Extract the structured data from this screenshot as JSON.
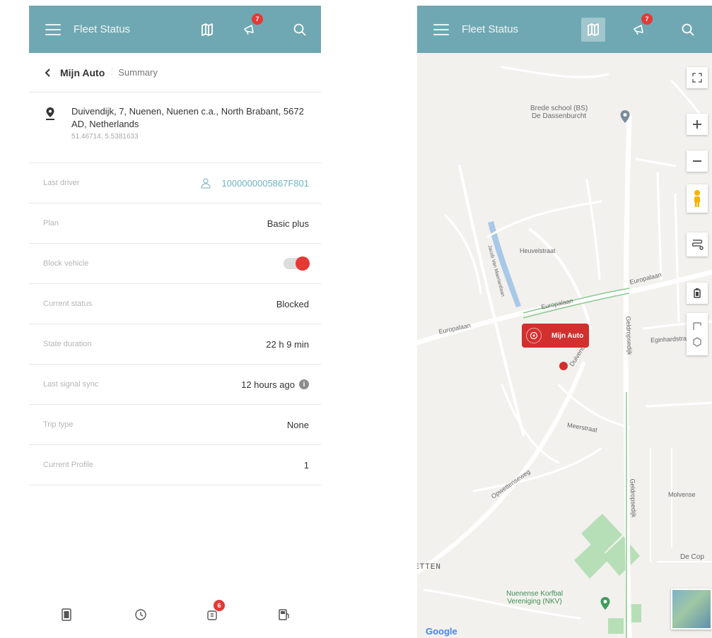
{
  "app": {
    "title": "Fleet Status",
    "notification_count": "7",
    "accent": "#6fa8b3",
    "alert": "#e53935"
  },
  "detail": {
    "car_name": "Mijn Auto",
    "tab": "Summary",
    "address": "Duivendijk, 7, Nuenen, Nuenen c.a., North Brabant, 5672 AD, Netherlands",
    "coordinates": "51.46714, 5.5381633",
    "rows": [
      {
        "label": "Last driver",
        "value": "1000000005867F801"
      },
      {
        "label": "Plan",
        "value": "Basic plus"
      },
      {
        "label": "Block vehicle",
        "value": ""
      },
      {
        "label": "Current status",
        "value": "Blocked"
      },
      {
        "label": "State duration",
        "value": "22 h 9 min"
      },
      {
        "label": "Last signal sync",
        "value": "12 hours ago"
      },
      {
        "label": "Trip type",
        "value": "None"
      },
      {
        "label": "Current Profile",
        "value": "1"
      }
    ],
    "block_vehicle_on": true
  },
  "bottom_nav": {
    "badge_count": "6",
    "items": [
      "summary-icon",
      "history-icon",
      "alerts-icon",
      "fuel-icon"
    ]
  },
  "map": {
    "marker_label": "Mijn Auto",
    "pois": [
      {
        "name": "Brede school (BS)\nDe Dassenburcht"
      },
      {
        "name": "Nuenense Korfbal\nVereniging (NKV)"
      }
    ],
    "streets": [
      "Europalaan",
      "Europalaan",
      "Europalaan",
      "Geldropsedijk",
      "Geldropsedijk",
      "Opwettenseweg",
      "Duivendijk",
      "Heuvelstraat",
      "Eginhardstraat",
      "Molvense",
      "Meerstraat",
      "Jacob Van Maerlantlaan"
    ],
    "area_label": "ETTEN",
    "partial_label": "De Cop",
    "google_logo": "Google"
  }
}
